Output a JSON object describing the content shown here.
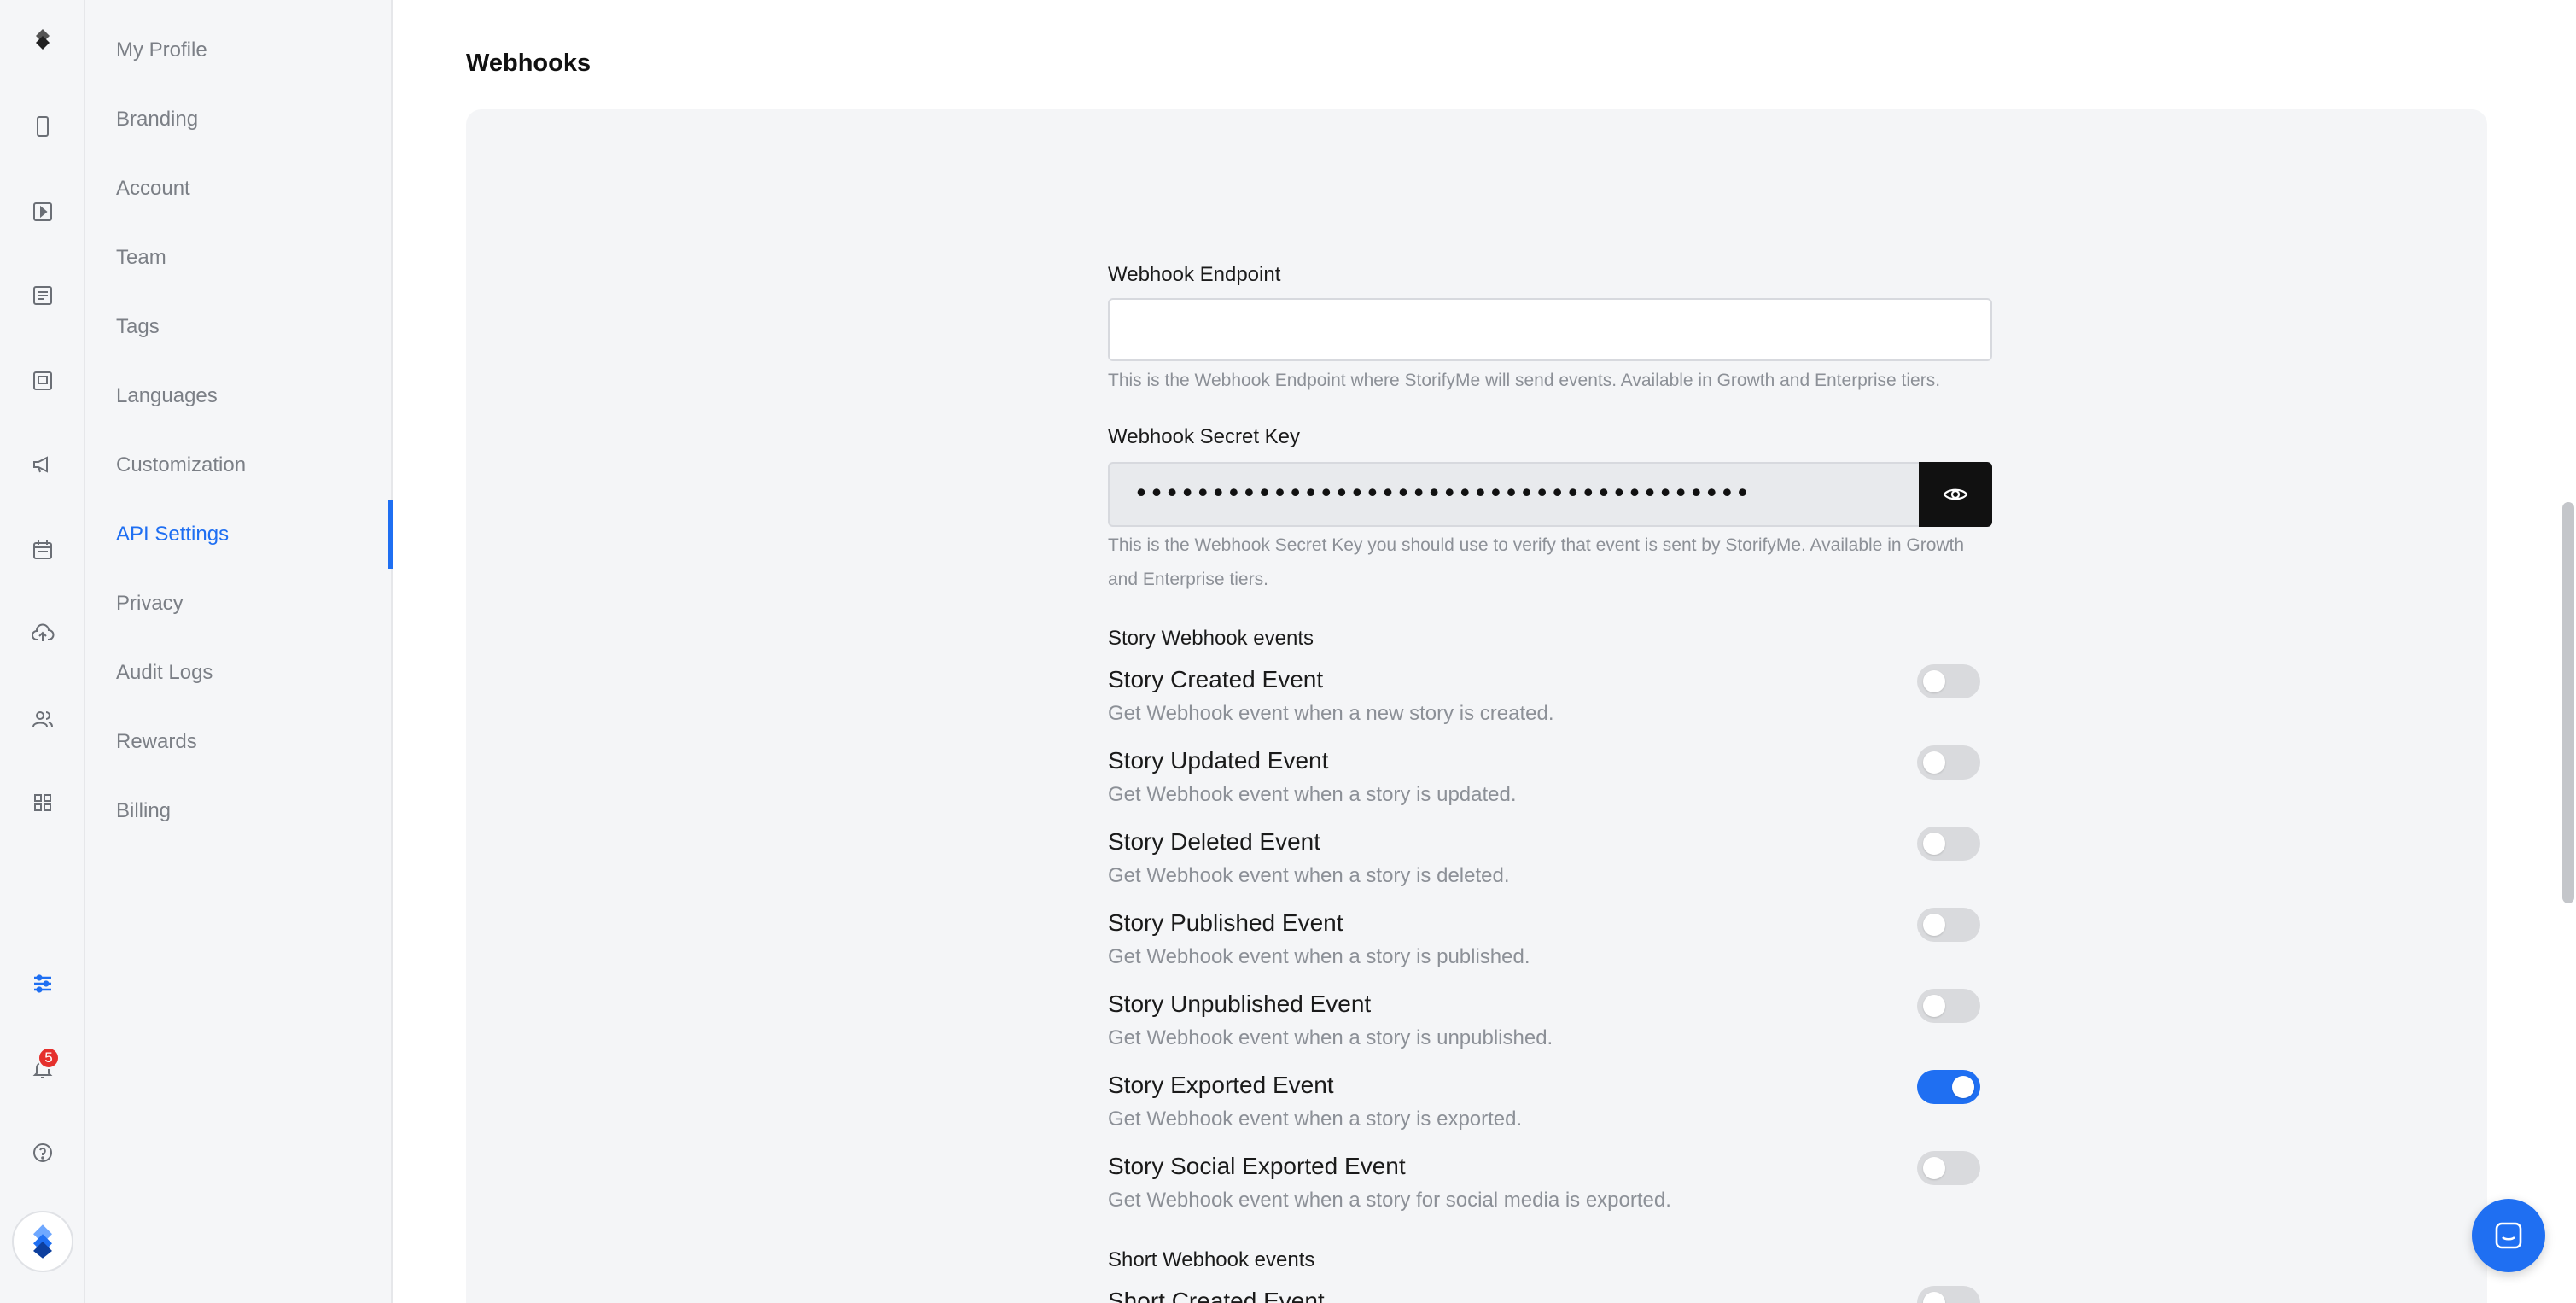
{
  "brand": {
    "accent": "#1f6ff2",
    "badge_color": "#e5302d"
  },
  "rail": {
    "icons": [
      "logo-icon",
      "phone-icon",
      "play-icon",
      "list-icon",
      "image-icon",
      "megaphone-icon",
      "calendar-icon",
      "cloud-upload-icon",
      "users-icon",
      "grid-icon",
      "sliders-icon",
      "bell-icon",
      "help-icon"
    ],
    "notification_count": "5"
  },
  "settings_nav": {
    "items": [
      {
        "label": "My Profile"
      },
      {
        "label": "Branding"
      },
      {
        "label": "Account"
      },
      {
        "label": "Team"
      },
      {
        "label": "Tags"
      },
      {
        "label": "Languages"
      },
      {
        "label": "Customization"
      },
      {
        "label": "API Settings",
        "active": true
      },
      {
        "label": "Privacy"
      },
      {
        "label": "Audit Logs"
      },
      {
        "label": "Rewards"
      },
      {
        "label": "Billing"
      }
    ]
  },
  "main": {
    "section_title": "Webhooks",
    "endpoint": {
      "label": "Webhook Endpoint",
      "value": "",
      "help": "This is the Webhook Endpoint where StorifyMe will send events. Available in Growth and Enterprise tiers."
    },
    "secret": {
      "label": "Webhook Secret Key",
      "masked_value": "••••••••••••••••••••••••••••••••••••••••",
      "help": "This is the Webhook Secret Key you should use to verify that event is sent by StorifyMe. Available in Growth and Enterprise tiers."
    },
    "story_events": {
      "title": "Story Webhook events",
      "items": [
        {
          "name": "Story Created Event",
          "desc": "Get Webhook event when a new story is created.",
          "enabled": false
        },
        {
          "name": "Story Updated Event",
          "desc": "Get Webhook event when a story is updated.",
          "enabled": false
        },
        {
          "name": "Story Deleted Event",
          "desc": "Get Webhook event when a story is deleted.",
          "enabled": false
        },
        {
          "name": "Story Published Event",
          "desc": "Get Webhook event when a story is published.",
          "enabled": false
        },
        {
          "name": "Story Unpublished Event",
          "desc": "Get Webhook event when a story is unpublished.",
          "enabled": false
        },
        {
          "name": "Story Exported Event",
          "desc": "Get Webhook event when a story is exported.",
          "enabled": true
        },
        {
          "name": "Story Social Exported Event",
          "desc": "Get Webhook event when a story for social media is exported.",
          "enabled": false
        }
      ]
    },
    "short_events": {
      "title": "Short Webhook events",
      "items": [
        {
          "name": "Short Created Event",
          "enabled": false
        }
      ]
    }
  }
}
